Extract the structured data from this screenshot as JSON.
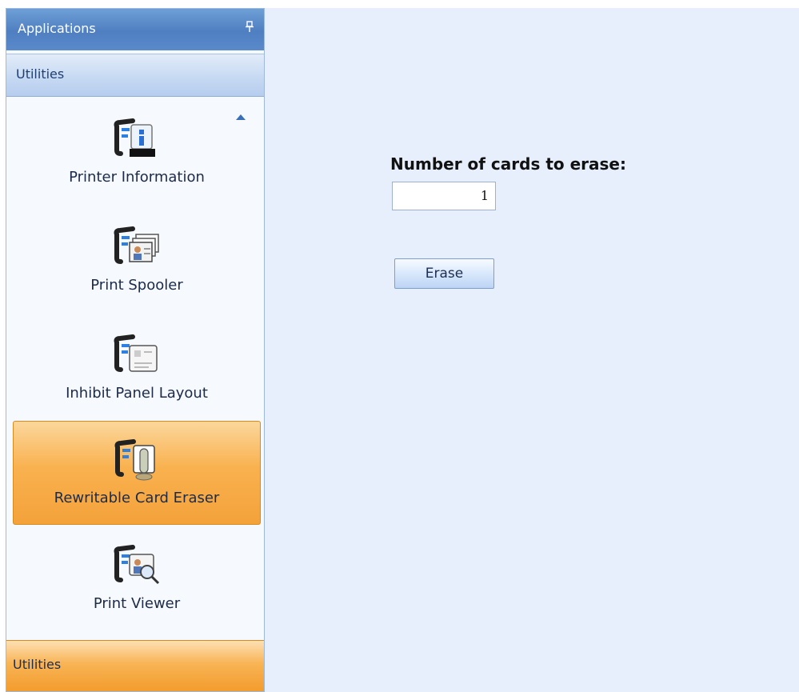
{
  "sidebar": {
    "title": "Applications",
    "pin_icon": "pin-icon",
    "pin_glyph": "↕",
    "group_label": "Utilities",
    "items": [
      {
        "label": "Printer Information",
        "icon": "printer-information-icon",
        "selected": false
      },
      {
        "label": "Print Spooler",
        "icon": "print-spooler-icon",
        "selected": false
      },
      {
        "label": "Inhibit Panel Layout",
        "icon": "inhibit-panel-layout-icon",
        "selected": false
      },
      {
        "label": "Rewritable Card Eraser",
        "icon": "rewritable-card-eraser-icon",
        "selected": true
      },
      {
        "label": "Print Viewer",
        "icon": "print-viewer-icon",
        "selected": false
      }
    ],
    "bottom_group_label": "Utilities"
  },
  "main": {
    "cards_label": "Number of cards to erase:",
    "cards_value": "1",
    "erase_button": "Erase"
  },
  "colors": {
    "header": "#5a8acb",
    "selection": "#f9b14f",
    "content_bg": "#e6effb"
  }
}
